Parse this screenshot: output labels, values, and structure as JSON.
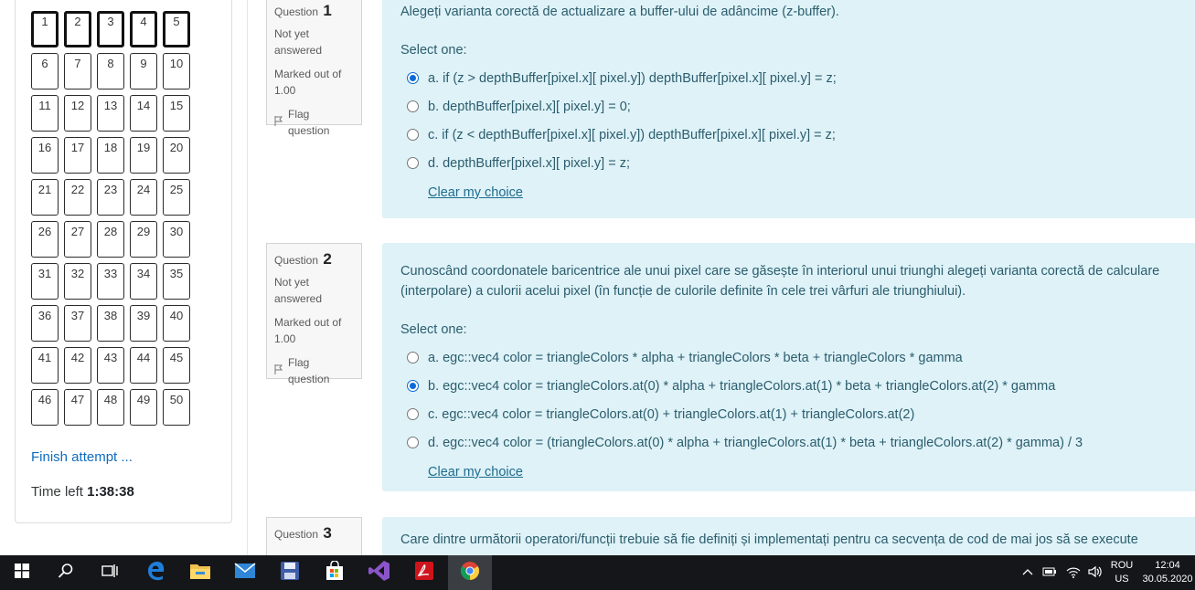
{
  "nav": {
    "buttons": [
      "1",
      "2",
      "3",
      "4",
      "5",
      "6",
      "7",
      "8",
      "9",
      "10",
      "11",
      "12",
      "13",
      "14",
      "15",
      "16",
      "17",
      "18",
      "19",
      "20",
      "21",
      "22",
      "23",
      "24",
      "25",
      "26",
      "27",
      "28",
      "29",
      "30",
      "31",
      "32",
      "33",
      "34",
      "35",
      "36",
      "37",
      "38",
      "39",
      "40",
      "41",
      "42",
      "43",
      "44",
      "45",
      "46",
      "47",
      "48",
      "49",
      "50"
    ],
    "finish_label": "Finish attempt ...",
    "time_label": "Time left",
    "time_value": "1:38:38"
  },
  "questions": [
    {
      "label": "Question",
      "number": "1",
      "state": "Not yet answered",
      "marked": "Marked out of 1.00",
      "flag": "Flag question",
      "prompt": "Alegeți varianta corectă de actualizare a buffer-ului de adâncime (z-buffer).",
      "select_one": "Select one:",
      "options": [
        {
          "text": "a. if (z > depthBuffer[pixel.x][ pixel.y]) depthBuffer[pixel.x][ pixel.y] = z;",
          "checked": true
        },
        {
          "text": "b. depthBuffer[pixel.x][ pixel.y] = 0;",
          "checked": false
        },
        {
          "text": "c. if (z < depthBuffer[pixel.x][ pixel.y]) depthBuffer[pixel.x][ pixel.y] = z;",
          "checked": false
        },
        {
          "text": "d. depthBuffer[pixel.x][ pixel.y] = z;",
          "checked": false
        }
      ],
      "clear": "Clear my choice"
    },
    {
      "label": "Question",
      "number": "2",
      "state": "Not yet answered",
      "marked": "Marked out of 1.00",
      "flag": "Flag question",
      "prompt": "Cunoscând coordonatele baricentrice ale unui pixel care se găsește în interiorul unui triunghi alegeți varianta corectă de calculare (interpolare) a culorii acelui pixel (în funcție de culorile definite în cele trei vârfuri ale triunghiului).",
      "select_one": "Select one:",
      "options": [
        {
          "text": "a. egc::vec4 color = triangleColors * alpha + triangleColors * beta + triangleColors * gamma",
          "checked": false
        },
        {
          "text": "b. egc::vec4 color = triangleColors.at(0) * alpha + triangleColors.at(1) * beta + triangleColors.at(2) * gamma",
          "checked": true
        },
        {
          "text": "c. egc::vec4 color = triangleColors.at(0) + triangleColors.at(1) + triangleColors.at(2)",
          "checked": false
        },
        {
          "text": "d. egc::vec4 color = (triangleColors.at(0) * alpha + triangleColors.at(1) * beta + triangleColors.at(2) * gamma) / 3",
          "checked": false
        }
      ],
      "clear": "Clear my choice"
    },
    {
      "label": "Question",
      "number": "3",
      "prompt": "Care dintre următorii operatori/funcții trebuie să fie definiți și implementați pentru ca secvența de cod de mai jos să se execute"
    }
  ],
  "taskbar": {
    "lang_top": "ROU",
    "lang_bottom": "US",
    "time": "12:04",
    "date": "30.05.2020",
    "icons": [
      "windows-start-icon",
      "search-icon",
      "task-view-icon",
      "edge-icon",
      "file-explorer-icon",
      "mail-icon",
      "save-app-icon",
      "store-icon",
      "visual-studio-icon",
      "acrobat-icon",
      "chrome-icon"
    ],
    "accent": "#3a3d42"
  }
}
